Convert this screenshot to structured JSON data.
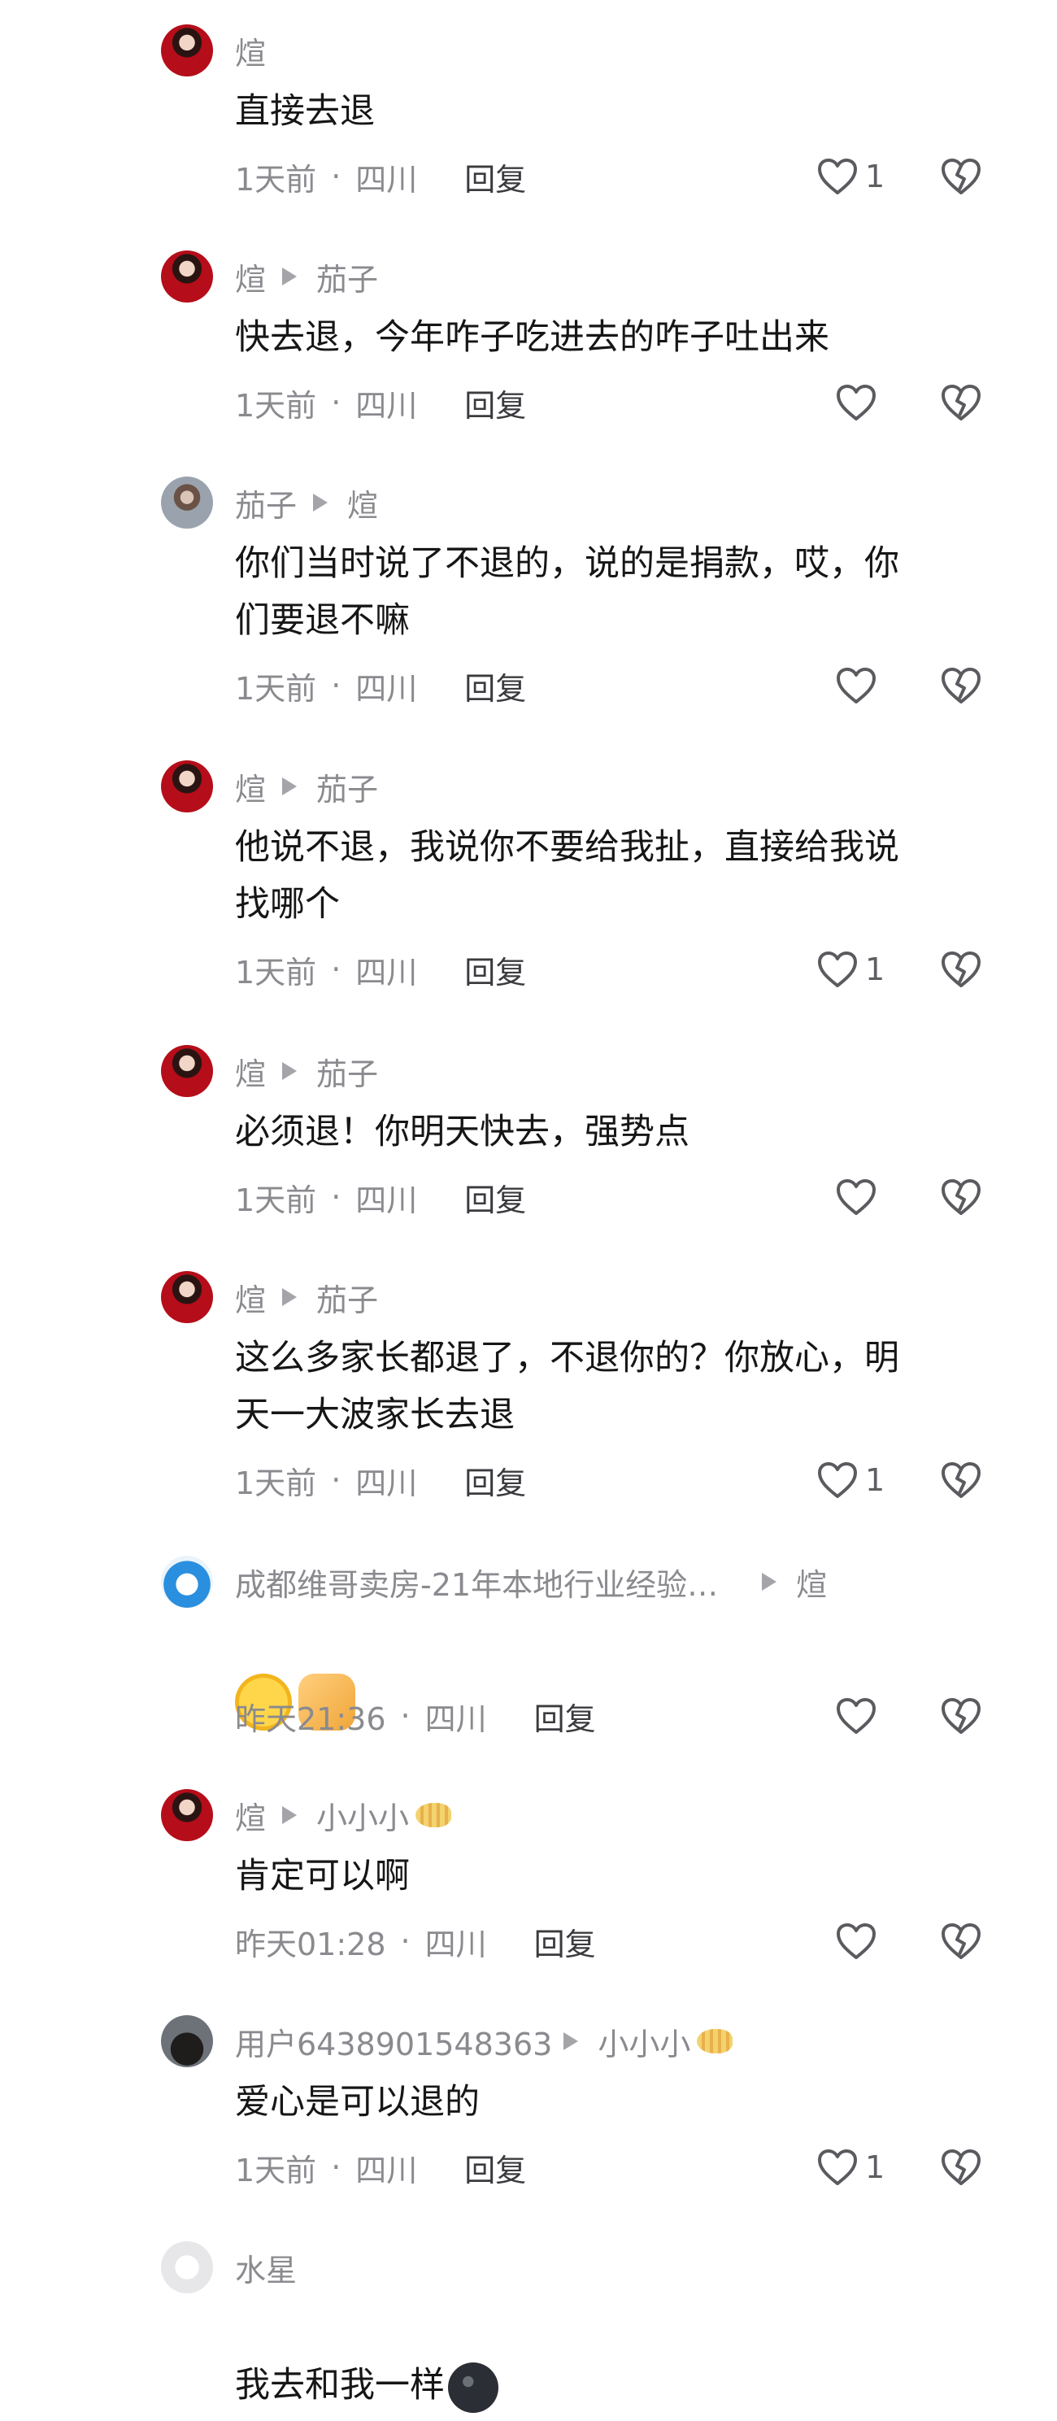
{
  "comments": [
    {
      "author": "煊",
      "reply_to": "",
      "text": "直接去退",
      "time": "1天前",
      "location": "四川",
      "reply": "回复",
      "likes": "1",
      "avatar": "xuan"
    },
    {
      "author": "煊",
      "reply_to": "茄子",
      "text": "快去退，今年咋子吃进去的咋子吐出来",
      "time": "1天前",
      "location": "四川",
      "reply": "回复",
      "likes": "",
      "avatar": "xuan"
    },
    {
      "author": "茄子",
      "reply_to": "煊",
      "text": "你们当时说了不退的，说的是捐款，哎，你\n们要退不嘛",
      "time": "1天前",
      "location": "四川",
      "reply": "回复",
      "likes": "",
      "avatar": "qiezi"
    },
    {
      "author": "煊",
      "reply_to": "茄子",
      "text": "他说不退，我说你不要给我扯，直接给我说\n找哪个",
      "time": "1天前",
      "location": "四川",
      "reply": "回复",
      "likes": "1",
      "avatar": "xuan"
    },
    {
      "author": "煊",
      "reply_to": "茄子",
      "text": "必须退！你明天快去，强势点",
      "time": "1天前",
      "location": "四川",
      "reply": "回复",
      "likes": "",
      "avatar": "xuan"
    },
    {
      "author": "煊",
      "reply_to": "茄子",
      "text": "这么多家长都退了，不退你的？你放心，明\n天一大波家长去退",
      "time": "1天前",
      "location": "四川",
      "reply": "回复",
      "likes": "1",
      "avatar": "xuan"
    },
    {
      "author": "成都维哥卖房-21年本地行业经验…",
      "reply_to": "煊",
      "text": "",
      "time": "昨天21:36",
      "location": "四川",
      "reply": "回复",
      "likes": "",
      "avatar": "dora",
      "emojis": [
        "laugh-cry-emoji",
        "thumbs-up-emoji"
      ]
    },
    {
      "author": "煊",
      "reply_to": "小小小",
      "text": "肯定可以啊",
      "time": "昨天01:28",
      "location": "四川",
      "reply": "回复",
      "likes": "",
      "avatar": "xuan",
      "reply_to_badge": "fish-badge-icon"
    },
    {
      "author": "用户6438901548363",
      "reply_to": "小小小",
      "text": "爱心是可以退的",
      "time": "1天前",
      "location": "四川",
      "reply": "回复",
      "likes": "1",
      "avatar": "user",
      "reply_to_badge": "fish-badge-icon"
    },
    {
      "author": "水星",
      "reply_to": "",
      "text": "我去和我一样",
      "time": "",
      "location": "",
      "reply": "",
      "likes": "",
      "avatar": "shui",
      "trailing_emoji": "blob-emoji"
    }
  ],
  "separator": "·",
  "icons": {
    "like": "heart-outline-icon",
    "dislike": "broken-heart-icon",
    "reply_arrow": "triangle-right-icon"
  },
  "colors": {
    "secondary_text": "#8a8a8f",
    "primary_text": "#161616",
    "reply_text": "#3b3b3f"
  }
}
